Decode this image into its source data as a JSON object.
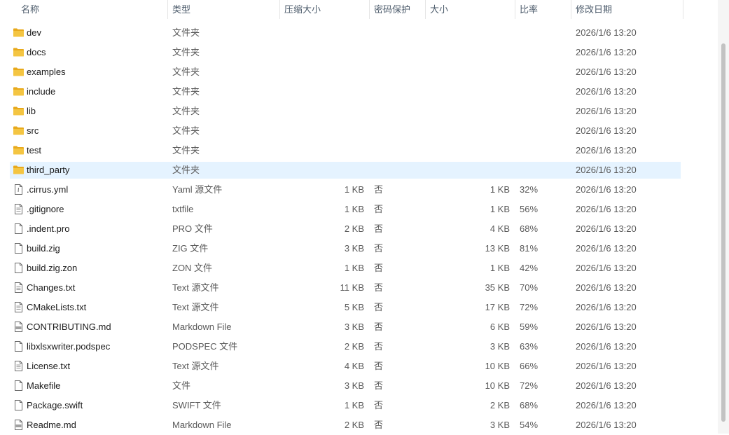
{
  "headers": {
    "name": "名称",
    "type": "类型",
    "packed": "压缩大小",
    "encrypted": "密码保护",
    "size": "大小",
    "ratio": "比率",
    "date": "修改日期"
  },
  "sort_indicator": "^",
  "folder_color": "#f4c542",
  "selected_color": "#e5f3ff",
  "files": [
    {
      "name": "dev",
      "type": "文件夹",
      "packed": "",
      "encrypted": "",
      "size": "",
      "ratio": "",
      "date": "2026/1/6 13:20",
      "icon": "folder-icon"
    },
    {
      "name": "docs",
      "type": "文件夹",
      "packed": "",
      "encrypted": "",
      "size": "",
      "ratio": "",
      "date": "2026/1/6 13:20",
      "icon": "folder-icon"
    },
    {
      "name": "examples",
      "type": "文件夹",
      "packed": "",
      "encrypted": "",
      "size": "",
      "ratio": "",
      "date": "2026/1/6 13:20",
      "icon": "folder-icon"
    },
    {
      "name": "include",
      "type": "文件夹",
      "packed": "",
      "encrypted": "",
      "size": "",
      "ratio": "",
      "date": "2026/1/6 13:20",
      "icon": "folder-icon"
    },
    {
      "name": "lib",
      "type": "文件夹",
      "packed": "",
      "encrypted": "",
      "size": "",
      "ratio": "",
      "date": "2026/1/6 13:20",
      "icon": "folder-icon"
    },
    {
      "name": "src",
      "type": "文件夹",
      "packed": "",
      "encrypted": "",
      "size": "",
      "ratio": "",
      "date": "2026/1/6 13:20",
      "icon": "folder-icon"
    },
    {
      "name": "test",
      "type": "文件夹",
      "packed": "",
      "encrypted": "",
      "size": "",
      "ratio": "",
      "date": "2026/1/6 13:20",
      "icon": "folder-icon"
    },
    {
      "name": "third_party",
      "type": "文件夹",
      "packed": "",
      "encrypted": "",
      "size": "",
      "ratio": "",
      "date": "2026/1/6 13:20",
      "icon": "folder-icon",
      "selected": true
    },
    {
      "name": ".cirrus.yml",
      "type": "Yaml 源文件",
      "packed": "1 KB",
      "encrypted": "否",
      "size": "1 KB",
      "ratio": "32%",
      "date": "2026/1/6 13:20",
      "icon": "yaml-file-icon"
    },
    {
      "name": ".gitignore",
      "type": "txtfile",
      "packed": "1 KB",
      "encrypted": "否",
      "size": "1 KB",
      "ratio": "56%",
      "date": "2026/1/6 13:20",
      "icon": "text-file-icon"
    },
    {
      "name": ".indent.pro",
      "type": "PRO 文件",
      "packed": "2 KB",
      "encrypted": "否",
      "size": "4 KB",
      "ratio": "68%",
      "date": "2026/1/6 13:20",
      "icon": "blank-file-icon"
    },
    {
      "name": "build.zig",
      "type": "ZIG 文件",
      "packed": "3 KB",
      "encrypted": "否",
      "size": "13 KB",
      "ratio": "81%",
      "date": "2026/1/6 13:20",
      "icon": "blank-file-icon"
    },
    {
      "name": "build.zig.zon",
      "type": "ZON 文件",
      "packed": "1 KB",
      "encrypted": "否",
      "size": "1 KB",
      "ratio": "42%",
      "date": "2026/1/6 13:20",
      "icon": "blank-file-icon"
    },
    {
      "name": "Changes.txt",
      "type": "Text 源文件",
      "packed": "11 KB",
      "encrypted": "否",
      "size": "35 KB",
      "ratio": "70%",
      "date": "2026/1/6 13:20",
      "icon": "text-file-icon"
    },
    {
      "name": "CMakeLists.txt",
      "type": "Text 源文件",
      "packed": "5 KB",
      "encrypted": "否",
      "size": "17 KB",
      "ratio": "72%",
      "date": "2026/1/6 13:20",
      "icon": "text-file-icon"
    },
    {
      "name": "CONTRIBUTING.md",
      "type": "Markdown File",
      "packed": "3 KB",
      "encrypted": "否",
      "size": "6 KB",
      "ratio": "59%",
      "date": "2026/1/6 13:20",
      "icon": "markdown-file-icon"
    },
    {
      "name": "libxlsxwriter.podspec",
      "type": "PODSPEC 文件",
      "packed": "2 KB",
      "encrypted": "否",
      "size": "3 KB",
      "ratio": "63%",
      "date": "2026/1/6 13:20",
      "icon": "blank-file-icon"
    },
    {
      "name": "License.txt",
      "type": "Text 源文件",
      "packed": "4 KB",
      "encrypted": "否",
      "size": "10 KB",
      "ratio": "66%",
      "date": "2026/1/6 13:20",
      "icon": "text-file-icon"
    },
    {
      "name": "Makefile",
      "type": "文件",
      "packed": "3 KB",
      "encrypted": "否",
      "size": "10 KB",
      "ratio": "72%",
      "date": "2026/1/6 13:20",
      "icon": "blank-file-icon"
    },
    {
      "name": "Package.swift",
      "type": "SWIFT 文件",
      "packed": "1 KB",
      "encrypted": "否",
      "size": "2 KB",
      "ratio": "68%",
      "date": "2026/1/6 13:20",
      "icon": "blank-file-icon"
    },
    {
      "name": "Readme.md",
      "type": "Markdown File",
      "packed": "2 KB",
      "encrypted": "否",
      "size": "3 KB",
      "ratio": "54%",
      "date": "2026/1/6 13:20",
      "icon": "markdown-file-icon"
    }
  ]
}
